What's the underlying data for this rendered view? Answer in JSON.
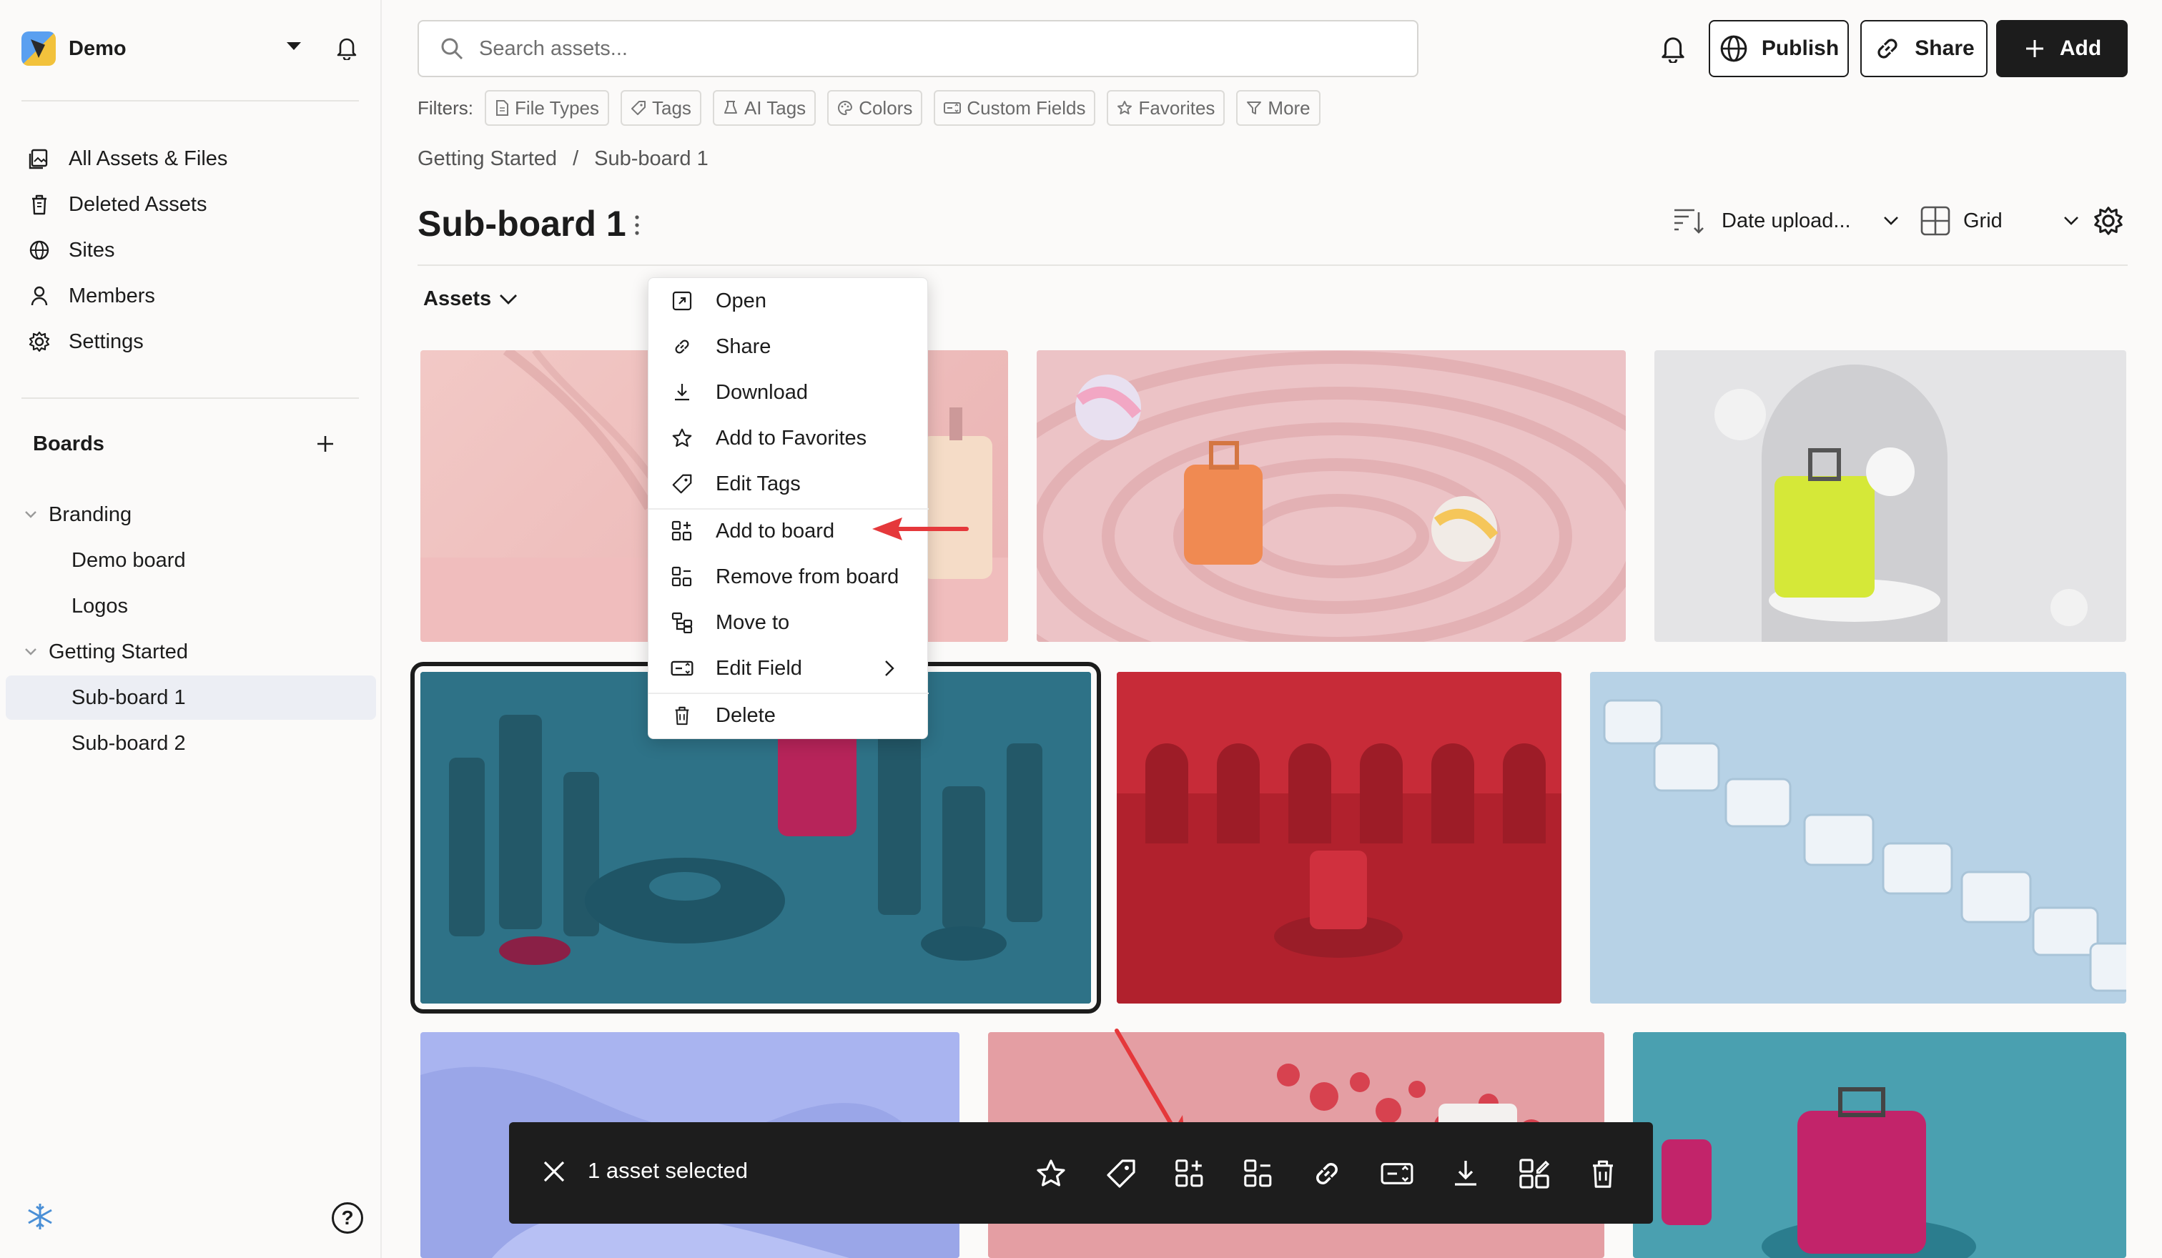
{
  "workspace": {
    "name": "Demo"
  },
  "nav": [
    {
      "label": "All Assets & Files",
      "icon": "assets-icon"
    },
    {
      "label": "Deleted Assets",
      "icon": "trash-icon"
    },
    {
      "label": "Sites",
      "icon": "globe-icon"
    },
    {
      "label": "Members",
      "icon": "user-icon"
    },
    {
      "label": "Settings",
      "icon": "gear-icon"
    }
  ],
  "boards": {
    "title": "Boards",
    "items": [
      {
        "label": "Branding"
      },
      {
        "label": "Demo board"
      },
      {
        "label": "Logos"
      },
      {
        "label": "Getting Started"
      },
      {
        "label": "Sub-board 1"
      },
      {
        "label": "Sub-board 2"
      }
    ]
  },
  "search": {
    "placeholder": "Search assets..."
  },
  "actions": {
    "publish": "Publish",
    "share": "Share",
    "add": "Add"
  },
  "filters": {
    "label": "Filters:",
    "chips": [
      "File Types",
      "Tags",
      "AI Tags",
      "Colors",
      "Custom Fields",
      "Favorites",
      "More"
    ]
  },
  "breadcrumb": {
    "parent": "Getting Started",
    "separator": "/",
    "current": "Sub-board 1"
  },
  "page": {
    "title": "Sub-board 1",
    "assets_label": "Assets"
  },
  "sort": {
    "label": "Date upload..."
  },
  "view": {
    "label": "Grid"
  },
  "context_menu": {
    "items": [
      {
        "label": "Open",
        "icon": "open-icon"
      },
      {
        "label": "Share",
        "icon": "link-icon"
      },
      {
        "label": "Download",
        "icon": "download-icon"
      },
      {
        "label": "Add to Favorites",
        "icon": "star-icon"
      },
      {
        "label": "Edit Tags",
        "icon": "tag-icon"
      },
      {
        "label": "Add to board",
        "icon": "add-board-icon"
      },
      {
        "label": "Remove from board",
        "icon": "remove-board-icon"
      },
      {
        "label": "Move to",
        "icon": "move-icon"
      },
      {
        "label": "Edit Field",
        "icon": "field-icon"
      },
      {
        "label": "Delete",
        "icon": "trash-icon"
      }
    ]
  },
  "selection_bar": {
    "count_text": "1 asset selected"
  },
  "colors": {
    "annotation_arrow": "#e5383b",
    "dark": "#1c1c1c"
  }
}
